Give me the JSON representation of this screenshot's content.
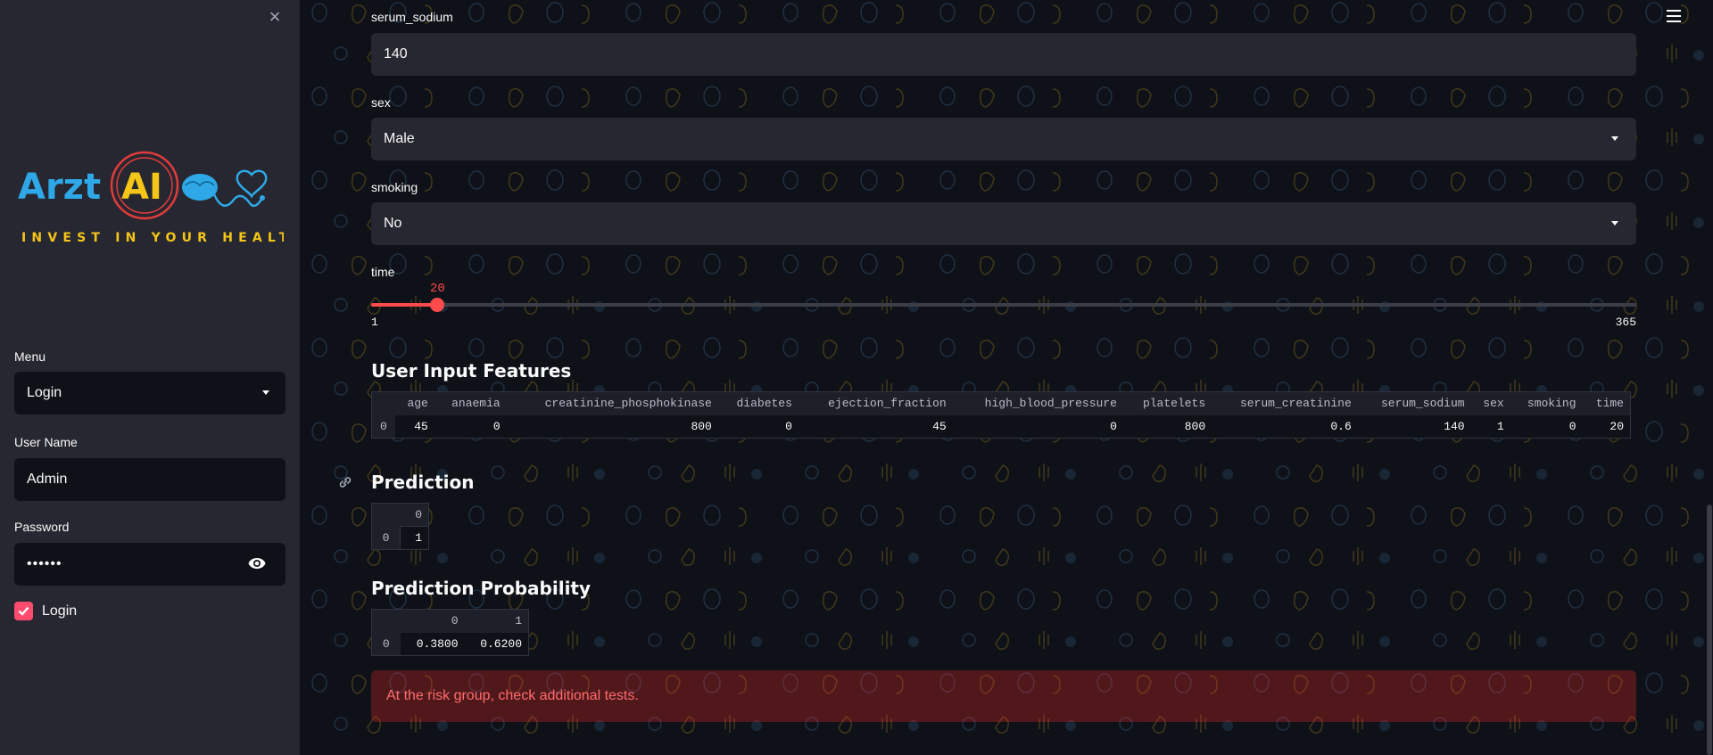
{
  "sidebar": {
    "close_glyph": "×",
    "logo": {
      "brand_part1": "Arzt",
      "brand_part2": "AI",
      "tagline": "INVEST IN YOUR HEALTH",
      "colors": {
        "arzt": "#2ea8e6",
        "ai": "#f5c518",
        "ring": "#e23b3b",
        "tagline": "#f5c518"
      }
    },
    "menu": {
      "label": "Menu",
      "value": "Login"
    },
    "username": {
      "label": "User Name",
      "value": "Admin"
    },
    "password": {
      "label": "Password",
      "value": "••••••"
    },
    "login_checkbox": {
      "label": "Login",
      "checked": true
    }
  },
  "form": {
    "serum_sodium": {
      "label": "serum_sodium",
      "value": "140"
    },
    "sex": {
      "label": "sex",
      "value": "Male"
    },
    "smoking": {
      "label": "smoking",
      "value": "No"
    },
    "time": {
      "label": "time",
      "value": 20,
      "min": 1,
      "max": 365,
      "value_text": "20",
      "min_text": "1",
      "max_text": "365"
    }
  },
  "features": {
    "heading": "User Input Features",
    "columns": [
      "age",
      "anaemia",
      "creatinine_phosphokinase",
      "diabetes",
      "ejection_fraction",
      "high_blood_pressure",
      "platelets",
      "serum_creatinine",
      "serum_sodium",
      "sex",
      "smoking",
      "time"
    ],
    "row_index": "0",
    "values": [
      "45",
      "0",
      "800",
      "0",
      "45",
      "0",
      "800",
      "0.6",
      "140",
      "1",
      "0",
      "20"
    ]
  },
  "prediction": {
    "heading": "Prediction",
    "column": "0",
    "row_index": "0",
    "value": "1"
  },
  "probability": {
    "heading": "Prediction Probability",
    "columns": [
      "0",
      "1"
    ],
    "row_index": "0",
    "values": [
      "0.3800",
      "0.6200"
    ]
  },
  "alert": {
    "message": "At the risk group, check additional tests.",
    "color": "#ff6c6c"
  },
  "colors": {
    "accent": "#ff4b4b",
    "checkbox": "#ff4b6e"
  }
}
